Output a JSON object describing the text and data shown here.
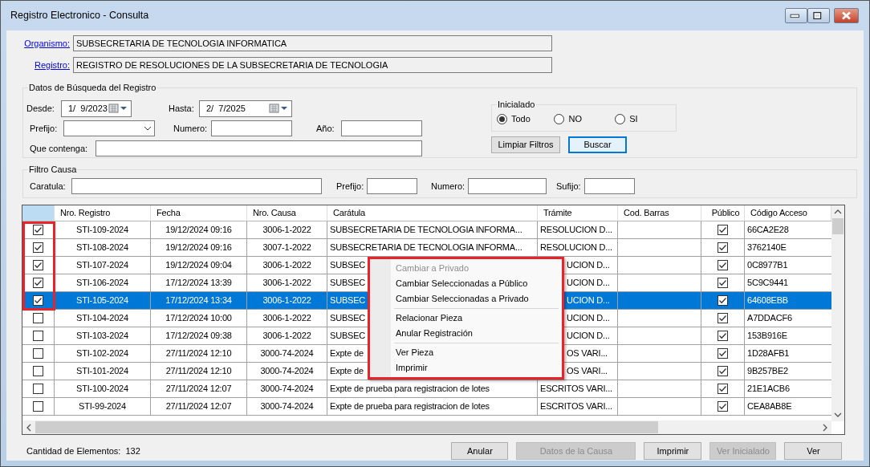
{
  "window": {
    "title": "Registro Electronico - Consulta"
  },
  "header_fields": [
    {
      "label": "Organismo:",
      "value": "SUBSECRETARIA DE TECNOLOGIA INFORMATICA"
    },
    {
      "label": "Registro:",
      "value": "REGISTRO DE RESOLUCIONES DE LA SUBSECRETARIA DE TECNOLOGIA"
    }
  ],
  "search": {
    "title": "Datos de Búsqueda del Registro",
    "desde": {
      "label": "Desde:",
      "value": "1/  9/2023"
    },
    "hasta": {
      "label": "Hasta:",
      "value": "2/  7/2025"
    },
    "prefijo": {
      "label": "Prefijo:"
    },
    "numero": {
      "label": "Numero:"
    },
    "anio": {
      "label": "Año:"
    },
    "que_contenga": {
      "label": "Que contenga:"
    },
    "inicialado": {
      "title": "Inicialado",
      "options": [
        {
          "label": "Todo",
          "selected": true
        },
        {
          "label": "NO",
          "selected": false
        },
        {
          "label": "SI",
          "selected": false
        }
      ]
    },
    "buttons": [
      {
        "label": "Limpiar Filtros",
        "focused": false
      },
      {
        "label": "Buscar",
        "focused": true
      }
    ]
  },
  "filtro_causa": {
    "title": "Filtro Causa",
    "fields": [
      {
        "label": "Caratula:"
      },
      {
        "label": "Prefijo:"
      },
      {
        "label": "Numero:"
      },
      {
        "label": "Sufijo:"
      }
    ]
  },
  "table": {
    "columns": [
      "Nro. Registro",
      "Fecha",
      "Nro. Causa",
      "Carátula",
      "Trámite",
      "Cod. Barras",
      "Público",
      "Código Acceso"
    ],
    "rows": [
      {
        "checked": true,
        "selected": false,
        "nro_registro": "STI-109-2024",
        "fecha": "19/12/2024 09:16",
        "nro_causa": "3006-1-2022",
        "caratula": "SUBSECRETARIA DE TECNOLOGIA INFORMA...",
        "tramite": "RESOLUCION D...",
        "publico": true,
        "codigo_acceso": "66CA2E28"
      },
      {
        "checked": true,
        "selected": false,
        "nro_registro": "STI-108-2024",
        "fecha": "19/12/2024 09:16",
        "nro_causa": "3007-1-2022",
        "caratula": "SUBSECRETARIA DE TECNOLOGIA INFORMA...",
        "tramite": "RESOLUCION D...",
        "publico": true,
        "codigo_acceso": "3762140E"
      },
      {
        "checked": true,
        "selected": false,
        "nro_registro": "STI-107-2024",
        "fecha": "19/12/2024 09:04",
        "nro_causa": "3006-1-2022",
        "caratula": "SUBSEC",
        "tramite": "UCION D...",
        "publico": true,
        "codigo_acceso": "0C8977B1"
      },
      {
        "checked": true,
        "selected": false,
        "nro_registro": "STI-106-2024",
        "fecha": "17/12/2024 13:39",
        "nro_causa": "3006-1-2022",
        "caratula": "SUBSEC",
        "tramite": "UCION D...",
        "publico": true,
        "codigo_acceso": "5C9C9441"
      },
      {
        "checked": true,
        "selected": true,
        "nro_registro": "STI-105-2024",
        "fecha": "17/12/2024 13:34",
        "nro_causa": "3006-1-2022",
        "caratula": "SUBSEC",
        "tramite": "UCION D...",
        "publico": true,
        "codigo_acceso": "64608EBB"
      },
      {
        "checked": false,
        "selected": false,
        "nro_registro": "STI-104-2024",
        "fecha": "17/12/2024 10:00",
        "nro_causa": "3006-1-2022",
        "caratula": "SUBSEC",
        "tramite": "UCION D...",
        "publico": true,
        "codigo_acceso": "A7DDACF6"
      },
      {
        "checked": false,
        "selected": false,
        "nro_registro": "STI-103-2024",
        "fecha": "17/12/2024 09:38",
        "nro_causa": "3006-1-2022",
        "caratula": "SUBSEC",
        "tramite": "UCION D...",
        "publico": true,
        "codigo_acceso": "153B916E"
      },
      {
        "checked": false,
        "selected": false,
        "nro_registro": "STI-102-2024",
        "fecha": "27/11/2024 12:10",
        "nro_causa": "3000-74-2024",
        "caratula": "Expte de",
        "tramite": "OS VARI...",
        "publico": true,
        "codigo_acceso": "1D28AFB1"
      },
      {
        "checked": false,
        "selected": false,
        "nro_registro": "STI-101-2024",
        "fecha": "27/11/2024 12:10",
        "nro_causa": "3000-74-2024",
        "caratula": "Expte de",
        "tramite": "OS VARI...",
        "publico": true,
        "codigo_acceso": "9B257BE2"
      },
      {
        "checked": false,
        "selected": false,
        "nro_registro": "STI-100-2024",
        "fecha": "27/11/2024 12:07",
        "nro_causa": "3000-74-2024",
        "caratula": "Expte de prueba para registracion de lotes",
        "tramite": "ESCRITOS VARI...",
        "publico": true,
        "codigo_acceso": "21E1ACB6"
      },
      {
        "checked": false,
        "selected": false,
        "nro_registro": "STI-99-2024",
        "fecha": "27/11/2024 12:07",
        "nro_causa": "3000-74-2024",
        "caratula": "Expte de prueba para registracion de lotes",
        "tramite": "ESCRITOS VARI...",
        "publico": true,
        "codigo_acceso": "CEA8AB8E"
      }
    ]
  },
  "context_menu": {
    "items": [
      {
        "kind": "item",
        "label": "Cambiar a Privado",
        "disabled": true
      },
      {
        "kind": "item",
        "label": "Cambiar Seleccionadas a Público",
        "disabled": false
      },
      {
        "kind": "item",
        "label": "Cambiar Seleccionadas a Privado",
        "disabled": false
      },
      {
        "kind": "separator"
      },
      {
        "kind": "item",
        "label": "Relacionar Pieza",
        "disabled": false
      },
      {
        "kind": "item",
        "label": "Anular Registración",
        "disabled": false
      },
      {
        "kind": "separator"
      },
      {
        "kind": "item",
        "label": "Ver Pieza",
        "disabled": false
      },
      {
        "kind": "item",
        "label": "Imprimir",
        "disabled": false
      }
    ]
  },
  "status": {
    "label": "Cantidad de Elementos:",
    "value": "132"
  },
  "buttons": [
    {
      "label": "Anular",
      "disabled": false
    },
    {
      "label": "Datos de la Causa",
      "disabled": true
    },
    {
      "label": "Imprimir",
      "disabled": false
    },
    {
      "label": "Ver Inicialado",
      "disabled": true
    },
    {
      "label": "Ver",
      "disabled": false
    }
  ]
}
